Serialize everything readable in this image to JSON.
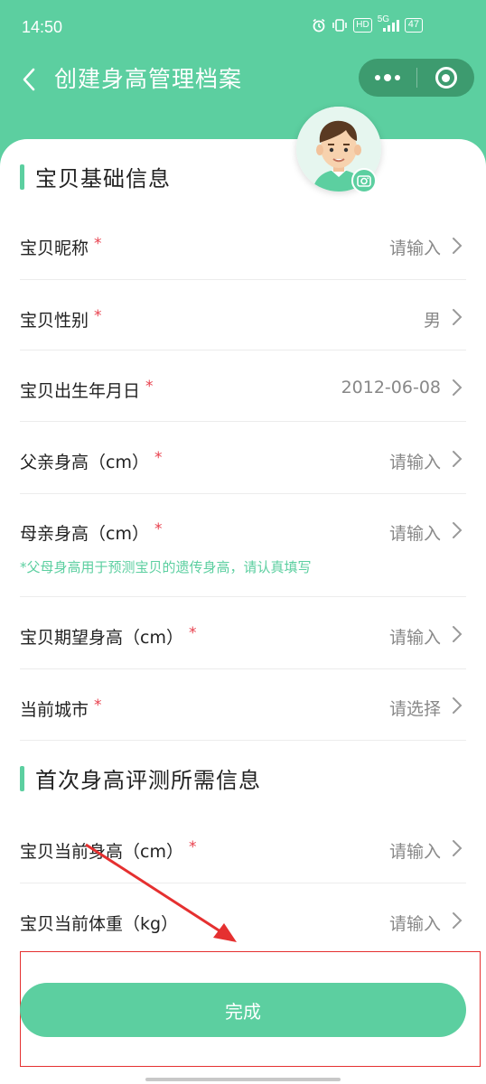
{
  "status": {
    "time": "14:50",
    "network": "5G",
    "battery": "47",
    "hd": "HD"
  },
  "nav": {
    "title": "创建身高管理档案"
  },
  "sections": {
    "basic": "宝贝基础信息",
    "assessment": "首次身高评测所需信息"
  },
  "fields": {
    "nickname": {
      "label": "宝贝昵称",
      "value": "请输入"
    },
    "gender": {
      "label": "宝贝性别",
      "value": "男"
    },
    "birthday": {
      "label": "宝贝出生年月日",
      "value": "2012-06-08"
    },
    "father_height": {
      "label": "父亲身高（cm）",
      "value": "请输入"
    },
    "mother_height": {
      "label": "母亲身高（cm）",
      "value": "请输入"
    },
    "expected_height": {
      "label": "宝贝期望身高（cm）",
      "value": "请输入"
    },
    "city": {
      "label": "当前城市",
      "value": "请选择"
    },
    "current_height": {
      "label": "宝贝当前身高（cm）",
      "value": "请输入"
    },
    "current_weight": {
      "label": "宝贝当前体重（kg）",
      "value": "请输入"
    }
  },
  "required_mark": "*",
  "hint": "*父母身高用于预测宝贝的遗传身高，请认真填写",
  "submit_label": "完成",
  "colors": {
    "primary": "#5ccfa0",
    "required": "#e8414e",
    "annotation": "#e53030"
  }
}
